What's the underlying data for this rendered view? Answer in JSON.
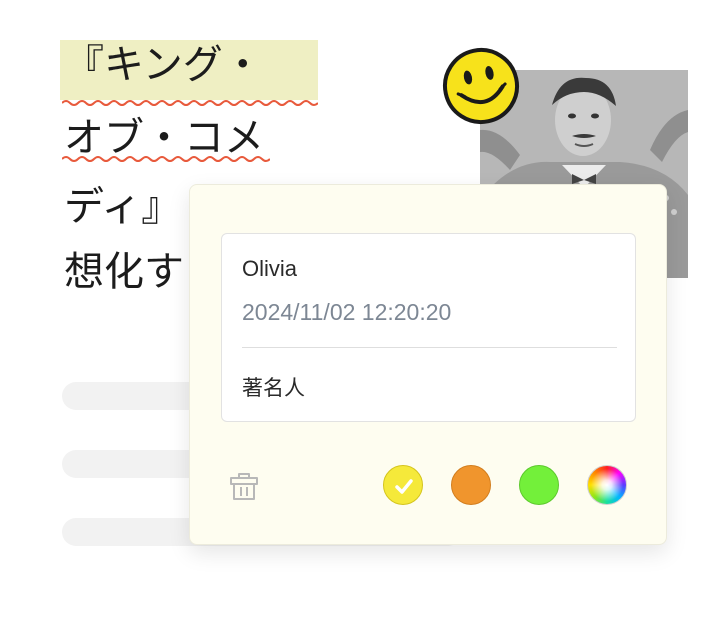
{
  "document": {
    "line1": "『キング・",
    "line2": "オブ・コメ",
    "line3": "ディ』",
    "line4": "想化す"
  },
  "annotation": {
    "author": "Olivia",
    "timestamp": "2024/11/02 12:20:20",
    "comment": "著名人"
  },
  "colors": {
    "highlight": "#efefc3",
    "yellow": "#f5e93a",
    "orange": "#f0952d",
    "green": "#73f03a",
    "squiggle": "#e85a3c",
    "selected": "yellow"
  },
  "icons": {
    "delete": "trash-icon",
    "selected": "check-icon",
    "picker": "color-wheel-icon",
    "sticker": "smiley-face-icon"
  }
}
